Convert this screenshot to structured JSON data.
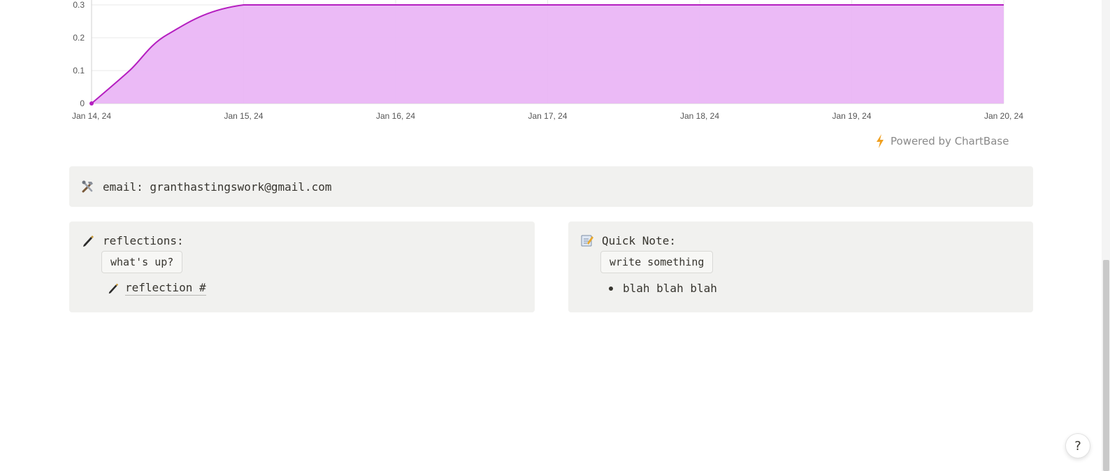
{
  "chart_data": {
    "type": "area",
    "x": [
      "Jan 14, 24",
      "Jan 14, 24 06:00",
      "Jan 14, 24 12:00",
      "Jan 15, 24",
      "Jan 16, 24",
      "Jan 17, 24",
      "Jan 18, 24",
      "Jan 19, 24",
      "Jan 20, 24"
    ],
    "x_ticks": [
      "Jan 14, 24",
      "Jan 15, 24",
      "Jan 16, 24",
      "Jan 17, 24",
      "Jan 18, 24",
      "Jan 19, 24",
      "Jan 20, 24"
    ],
    "y_ticks": [
      "0",
      "0.1",
      "0.2",
      "0.3"
    ],
    "series": [
      {
        "values": [
          0,
          0.1,
          0.21,
          0.3,
          0.3,
          0.3,
          0.3,
          0.3,
          0.3
        ]
      }
    ],
    "ylim": [
      0,
      0.3
    ],
    "grid": true,
    "line_color": "#b51fc0",
    "fill_color": "#eab6f6"
  },
  "powered_by": "Powered by ChartBase",
  "email_callout": {
    "icon": "tools-icon",
    "text": "email: granthastingswork@gmail.com"
  },
  "reflections": {
    "icon": "pen-icon",
    "title": "reflections:",
    "button_label": "what's up?",
    "item": "reflection #"
  },
  "quick_note": {
    "icon": "memo-icon",
    "title": "Quick Note:",
    "button_label": "write something",
    "bullet": "blah blah blah"
  },
  "help_label": "?"
}
